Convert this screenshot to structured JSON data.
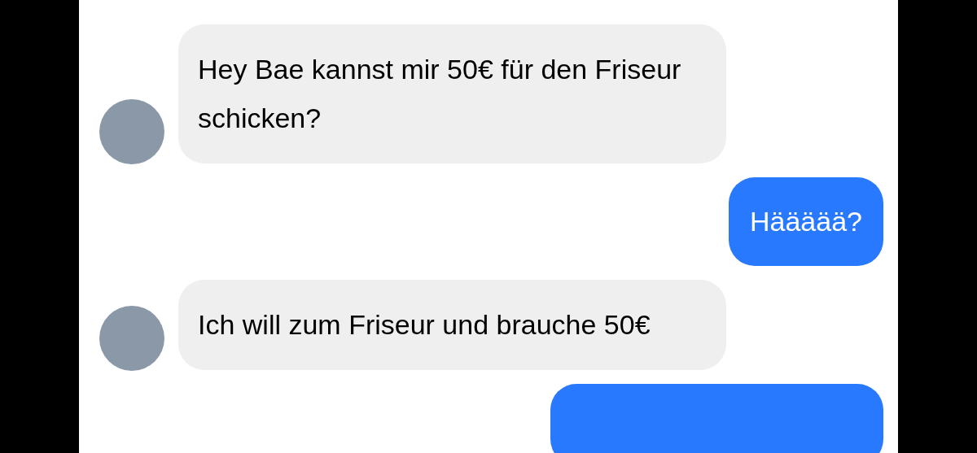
{
  "messages": [
    {
      "kind": "received",
      "text": "Hey Bae kannst mir 50€ für den Friseur schicken?"
    },
    {
      "kind": "sent",
      "text": "Häääää?"
    },
    {
      "kind": "received",
      "text": "Ich will zum Friseur und brauche 50€"
    },
    {
      "kind": "sent"
    }
  ]
}
